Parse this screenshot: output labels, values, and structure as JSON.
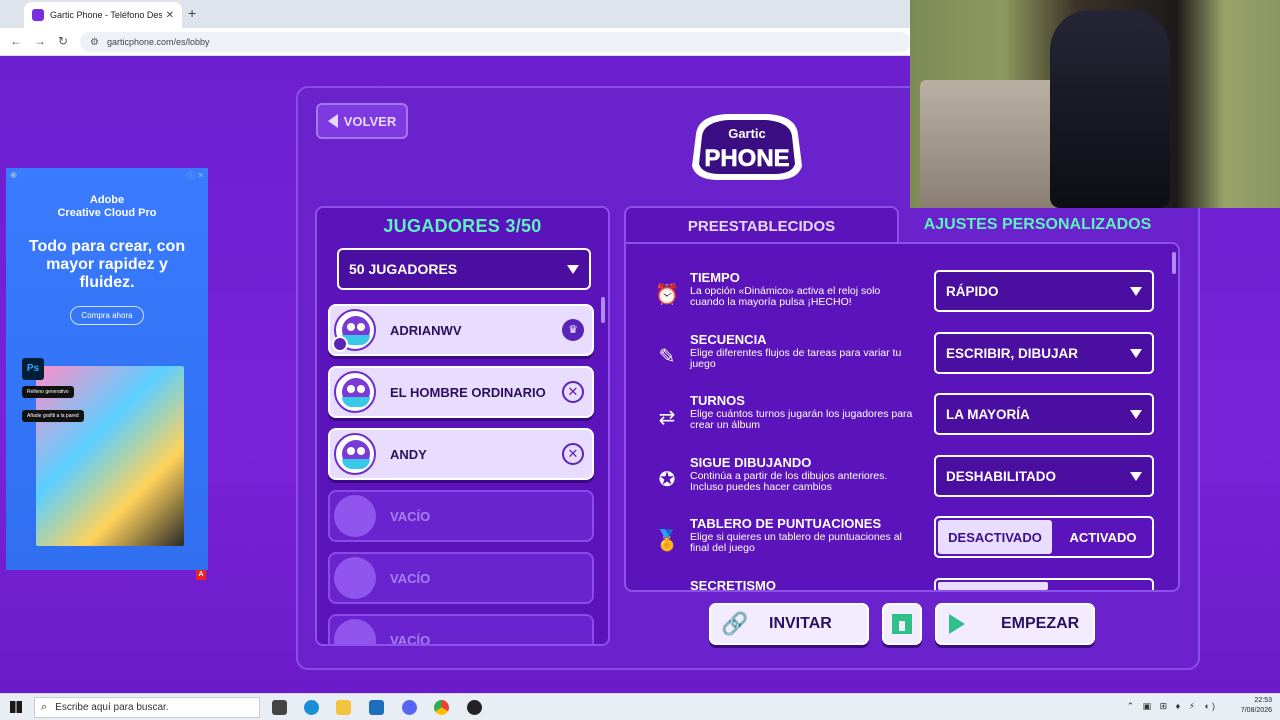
{
  "browser": {
    "tab_title": "Gartic Phone - Teléfono Descom",
    "url": "garticphone.com/es/lobby"
  },
  "ad": {
    "brand_line1": "Adobe",
    "brand_line2": "Creative Cloud Pro",
    "headline": "Todo para crear, con mayor rapidez y fluidez.",
    "cta": "Compra ahora",
    "badge": "Ps",
    "chip1": "Relleno generativo",
    "chip2": "Añade grafiti a la pared",
    "mark": "A"
  },
  "header": {
    "back_label": "VOLVER",
    "logo_line1": "Gartic",
    "logo_line2": "PHONE"
  },
  "players": {
    "title": "JUGADORES 3/50",
    "capacity_select": "50 JUGADORES",
    "list": [
      {
        "name": "ADRIANWV",
        "action": "crown"
      },
      {
        "name": "EL HOMBRE ORDINARIO",
        "action": "kick"
      },
      {
        "name": "ANDY",
        "action": "kick"
      },
      {
        "name": "VACÍO",
        "action": "none"
      },
      {
        "name": "VACÍO",
        "action": "none"
      },
      {
        "name": "VACÍO",
        "action": "none"
      }
    ]
  },
  "settings": {
    "tab_presets": "PREESTABLECIDOS",
    "tab_custom": "AJUSTES PERSONALIZADOS",
    "rows": [
      {
        "title": "TIEMPO",
        "desc": "La opción «Dinámico» activa el reloj solo cuando la mayoría pulsa ¡HECHO!",
        "value": "RÁPIDO",
        "icon": "alarm-clock-icon"
      },
      {
        "title": "SECUENCIA",
        "desc": "Elige diferentes flujos de tareas para variar tu juego",
        "value": "ESCRIBIR, DIBUJAR",
        "icon": "pencil-speech-icon"
      },
      {
        "title": "TURNOS",
        "desc": "Elige cuántos turnos jugarán los jugadores para crear un álbum",
        "value": "LA MAYORÍA",
        "icon": "turns-arrows-icon"
      },
      {
        "title": "SIGUE DIBUJANDO",
        "desc": "Continúa a partir de los dibujos anteriores. Incluso puedes hacer cambios",
        "value": "DESHABILITADO",
        "icon": "drawing-star-icon"
      },
      {
        "title": "TABLERO DE PUNTUACIONES",
        "desc": "Elige si quieres un tablero de puntuaciones al final del juego",
        "toggle_off": "DESACTIVADO",
        "toggle_on": "ACTIVADO",
        "icon": "medal-icon"
      },
      {
        "title": "SECRETISMO",
        "icon": "secret-icon"
      }
    ]
  },
  "actions": {
    "invite": "INVITAR",
    "start": "EMPEZAR"
  },
  "taskbar": {
    "search_placeholder": "Escribe aquí para buscar.",
    "time": "22:53",
    "date": "7/08/2026"
  }
}
